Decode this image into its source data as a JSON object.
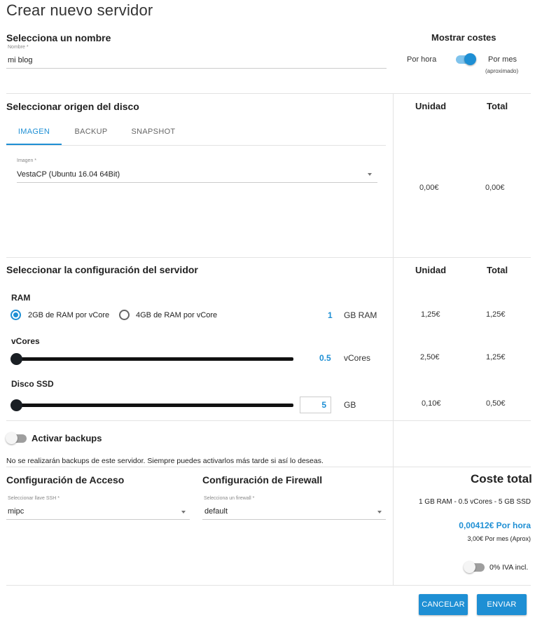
{
  "page": {
    "title": "Crear nuevo servidor"
  },
  "name_section": {
    "heading": "Selecciona un nombre",
    "field_label": "Nombre *",
    "field_value": "mi blog"
  },
  "costs_toggle": {
    "heading": "Mostrar costes",
    "left_label": "Por hora",
    "right_label": "Por mes",
    "right_sublabel": "(aproximado)",
    "enabled": true
  },
  "disk_section": {
    "heading": "Seleccionar origen del disco",
    "tabs": [
      {
        "label": "IMAGEN",
        "active": true
      },
      {
        "label": "BACKUP",
        "active": false
      },
      {
        "label": "SNAPSHOT",
        "active": false
      }
    ],
    "image_label": "Imagen *",
    "image_value": "VestaCP (Ubuntu 16.04 64Bit)",
    "unit_header": "Unidad",
    "total_header": "Total",
    "unit_price": "0,00€",
    "total_price": "0,00€"
  },
  "config_section": {
    "heading": "Seleccionar la configuración del servidor",
    "unit_header": "Unidad",
    "total_header": "Total",
    "ram": {
      "label": "RAM",
      "option1": "2GB de RAM por vCore",
      "option2": "4GB de RAM por vCore",
      "selected": 1,
      "amount": "1",
      "unit": "GB RAM",
      "unit_price": "1,25€",
      "total_price": "1,25€"
    },
    "vcores": {
      "label": "vCores",
      "amount": "0.5",
      "unit": "vCores",
      "slider_level": 0,
      "unit_price": "2,50€",
      "total_price": "1,25€"
    },
    "ssd": {
      "label": "Disco SSD",
      "amount": "5",
      "unit": "GB",
      "slider_level": 0,
      "unit_price": "0,10€",
      "total_price": "0,50€"
    }
  },
  "backups": {
    "label": "Activar backups",
    "enabled": false,
    "note": "No se realizarán backups de este servidor. Siempre puedes activarlos más tarde si así lo deseas."
  },
  "access": {
    "heading": "Configuración de Acceso",
    "field_label": "Seleccionar llave SSH *",
    "field_value": "mipc"
  },
  "firewall": {
    "heading": "Configuración de Firewall",
    "field_label": "Selecciona un firewall *",
    "field_value": "default"
  },
  "total": {
    "heading": "Coste total",
    "summary": "1 GB RAM - 0.5 vCores - 5 GB SSD",
    "hourly": "0,00412€ Por hora",
    "monthly": "3,00€ Por mes (Aprox)",
    "vat_label": "0% IVA incl.",
    "vat_enabled": false
  },
  "actions": {
    "cancel": "CANCELAR",
    "submit": "ENVIAR"
  },
  "colors": {
    "accent": "#1e8fd4",
    "toggle_track_on": "#7fc3ec",
    "toggle_off_thumb": "#f5f5f5",
    "toggle_off_track": "#9e9e9e"
  }
}
